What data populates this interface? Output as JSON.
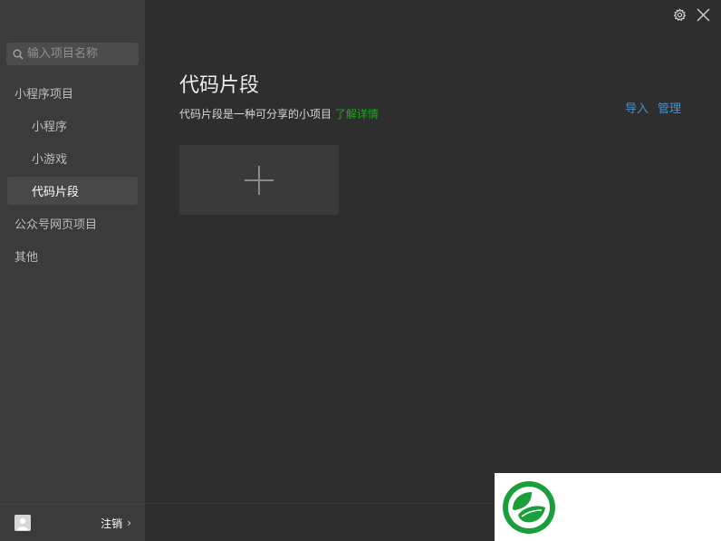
{
  "search": {
    "placeholder": "输入项目名称"
  },
  "sidebar": {
    "items": [
      {
        "label": "小程序项目",
        "level": 1,
        "active": false
      },
      {
        "label": "小程序",
        "level": 2,
        "active": false
      },
      {
        "label": "小游戏",
        "level": 2,
        "active": false
      },
      {
        "label": "代码片段",
        "level": 2,
        "active": true
      },
      {
        "label": "公众号网页项目",
        "level": 1,
        "active": false
      },
      {
        "label": "其他",
        "level": 1,
        "active": false
      }
    ],
    "footer": {
      "logout_label": "注销",
      "logout_chevron": "›"
    }
  },
  "main": {
    "title": "代码片段",
    "description": "代码片段是一种可分享的小项目",
    "learn_more": "了解详情",
    "actions": {
      "import": "导入",
      "manage": "管理"
    }
  },
  "icons": {
    "settings": "gear-icon",
    "close": "close-icon",
    "add": "plus-icon",
    "search": "search-icon",
    "avatar": "user-icon",
    "watermark": "leaf-logo-icon"
  },
  "colors": {
    "accent_green": "#1aad19",
    "link_blue": "#4e8fbf",
    "sidebar_bg": "#3b3b3b",
    "main_bg": "#2e2e2e"
  }
}
